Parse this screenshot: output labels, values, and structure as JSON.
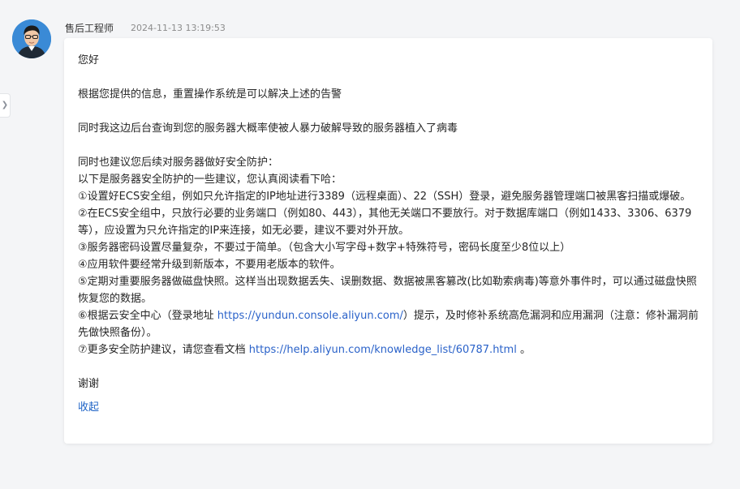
{
  "message": {
    "sender": "售后工程师",
    "timestamp": "2024-11-13 13:19:53",
    "greeting": "您好",
    "p1": "根据您提供的信息，重置操作系统是可以解决上述的告警",
    "p2": "同时我这边后台查询到您的服务器大概率使被人暴力破解导致的服务器植入了病毒",
    "advice_intro": "同时也建议您后续对服务器做好安全防护：",
    "advice_sub": "以下是服务器安全防护的一些建议，您认真阅读看下哈：",
    "item1": "①设置好ECS安全组，例如只允许指定的IP地址进行3389（远程桌面）、22（SSH）登录，避免服务器管理端口被黑客扫描或爆破。",
    "item2": "②在ECS安全组中，只放行必要的业务端口（例如80、443），其他无关端口不要放行。对于数据库端口（例如1433、3306、6379等），应设置为只允许指定的IP来连接，如无必要，建议不要对外开放。",
    "item3": "③服务器密码设置尽量复杂，不要过于简单。（包含大小写字母+数字+特殊符号，密码长度至少8位以上）",
    "item4": "④应用软件要经常升级到新版本，不要用老版本的软件。",
    "item5": "⑤定期对重要服务器做磁盘快照。这样当出现数据丢失、误删数据、数据被黑客篡改(比如勒索病毒)等意外事件时，可以通过磁盘快照恢复您的数据。",
    "item6_prefix": "⑥根据云安全中心（登录地址 ",
    "item6_link": "https://yundun.console.aliyun.com/",
    "item6_suffix": "）提示，及时修补系统高危漏洞和应用漏洞（注意：修补漏洞前先做快照备份）。",
    "item7_prefix": "⑦更多安全防护建议，请您查看文档 ",
    "item7_link": "https://help.aliyun.com/knowledge_list/60787.html",
    "item7_suffix": " 。",
    "thanks": "谢谢",
    "collapse_label": "收起"
  },
  "icons": {
    "side_toggle": "chevron-right-icon",
    "avatar": "engineer-avatar"
  },
  "colors": {
    "link": "#2a62c9",
    "collapse": "#1e63c6",
    "background": "#f4f5f7"
  }
}
